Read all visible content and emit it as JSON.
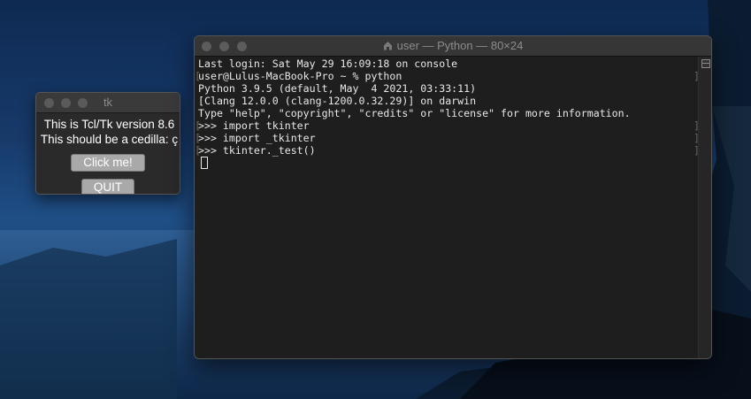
{
  "tk_window": {
    "title": "tk",
    "label1": "This is Tcl/Tk version 8.6",
    "label2": "This should be a cedilla: ç",
    "click_button": "Click me!",
    "quit_button": "QUIT"
  },
  "terminal": {
    "title": "user — Python — 80×24",
    "lines": [
      "Last login: Sat May 29 16:09:18 on console",
      "user@Lulus-MacBook-Pro ~ % python",
      "Python 3.9.5 (default, May  4 2021, 03:33:11)",
      "[Clang 12.0.0 (clang-1200.0.32.29)] on darwin",
      "Type \"help\", \"copyright\", \"credits\" or \"license\" for more information.",
      ">>> import tkinter",
      ">>> import _tkinter",
      ">>> tkinter._test()"
    ],
    "bracket": "[",
    "bracket_close": "]"
  },
  "colors": {
    "terminal_bg": "#1e1e1e",
    "terminal_text": "#e8e8e8",
    "tk_bg": "#2a2a2a",
    "tk_button": "#a9a9a9"
  },
  "icons": {
    "home": "home-icon",
    "close": "close-icon",
    "minimize": "minimize-icon",
    "zoom": "zoom-icon",
    "split": "split-pane-icon"
  }
}
